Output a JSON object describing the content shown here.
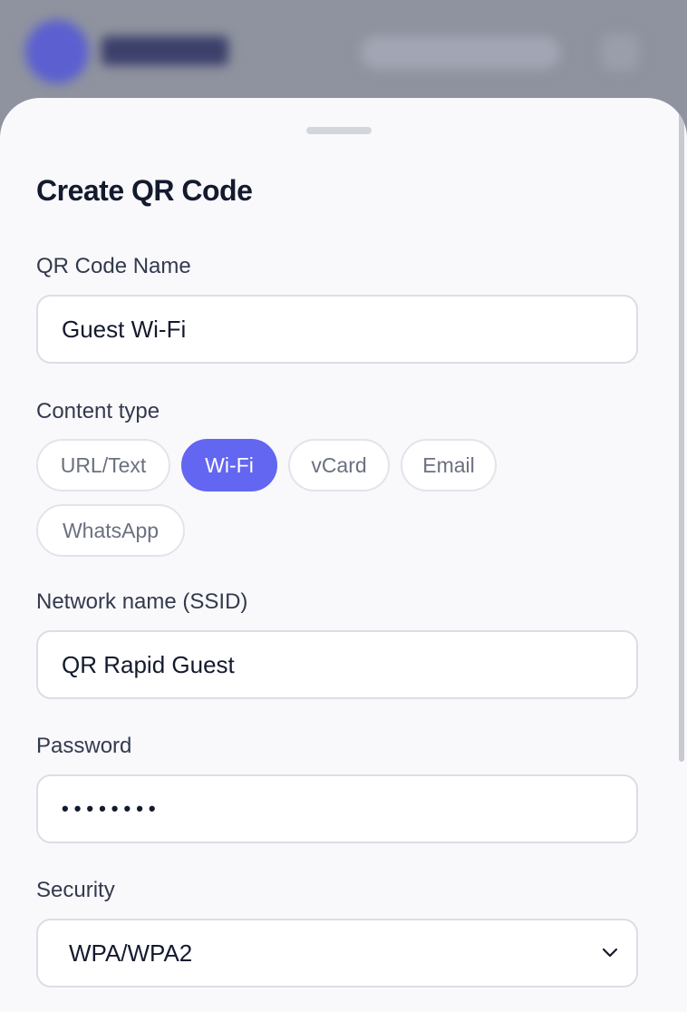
{
  "sheet": {
    "title": "Create QR Code"
  },
  "form": {
    "name_label": "QR Code Name",
    "name_value": "Guest Wi-Fi",
    "content_type_label": "Content type",
    "content_types": [
      {
        "label": "URL/Text",
        "active": false
      },
      {
        "label": "Wi-Fi",
        "active": true
      },
      {
        "label": "vCard",
        "active": false
      },
      {
        "label": "Email",
        "active": false
      },
      {
        "label": "WhatsApp",
        "active": false
      }
    ],
    "ssid_label": "Network name (SSID)",
    "ssid_value": "QR Rapid Guest",
    "password_label": "Password",
    "password_value": "••••••••",
    "security_label": "Security",
    "security_value": "WPA/WPA2"
  },
  "colors": {
    "accent": "#6366f1",
    "sheet_bg": "#f9f9fc",
    "overlay": "#8f939f"
  },
  "icons": {
    "select_chevron": "chevron-down-icon"
  }
}
